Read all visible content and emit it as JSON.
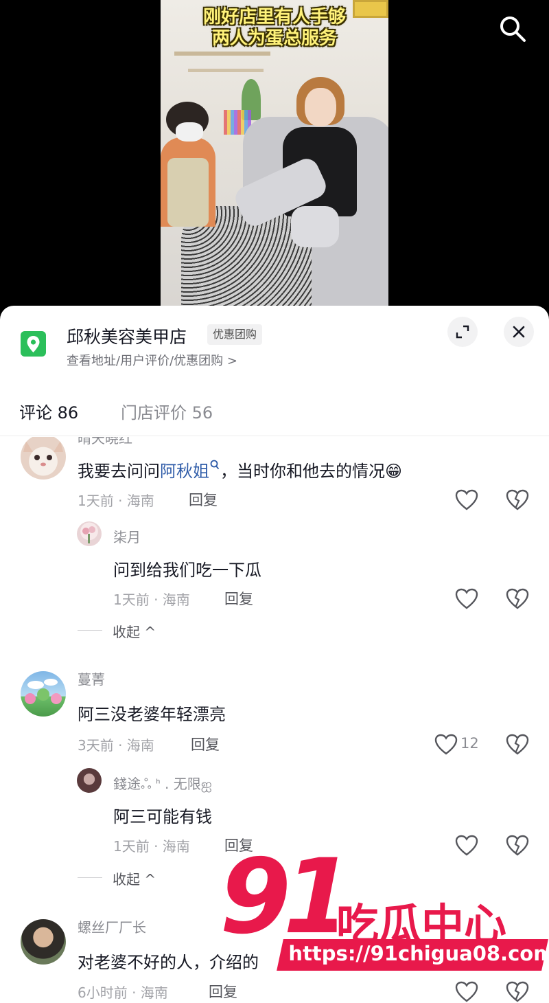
{
  "video": {
    "caption_line1": "刚好店里有人手够",
    "caption_line2": "两人为蛋总服务"
  },
  "store": {
    "name": "邱秋美容美甲店",
    "badge": "优惠团购",
    "subtitle": "查看地址/用户评价/优惠团购 >"
  },
  "tabs": {
    "comments": "评论 86",
    "store_reviews": "门店评价 56"
  },
  "comments": [
    {
      "username": "晴天晓红",
      "text_before": "我要去问问",
      "mention": "阿秋姐",
      "text_after": "，当时你和他去的情况😁",
      "meta": "1天前 · 海南",
      "reply": "回复",
      "likes": "",
      "replies": [
        {
          "username": "柒月",
          "text": "问到给我们吃一下瓜",
          "meta": "1天前 · 海南",
          "reply": "回复",
          "likes": ""
        }
      ],
      "collapse": "收起 ^"
    },
    {
      "username": "蔓菁",
      "text": "阿三没老婆年轻漂亮",
      "meta": "3天前 · 海南",
      "reply": "回复",
      "likes": "12",
      "replies": [
        {
          "username": "錢途ஃ ᑋ . 无限ஐ",
          "text": "阿三可能有钱",
          "meta": "1天前 · 海南",
          "reply": "回复",
          "likes": ""
        }
      ],
      "collapse": "收起 ^"
    },
    {
      "username": "螺丝厂厂长",
      "text": "对老婆不好的人，介绍的",
      "meta": "6小时前 · 海南",
      "reply": "回复",
      "likes": ""
    }
  ],
  "watermark": {
    "number": "91",
    "name": "吃瓜中心",
    "url": "https://91chigua08.com"
  },
  "colors": {
    "store_icon": "#2bbf5a",
    "mention": "#2e5ba8",
    "watermark": "#e8194b",
    "caption": "#fff27a"
  }
}
